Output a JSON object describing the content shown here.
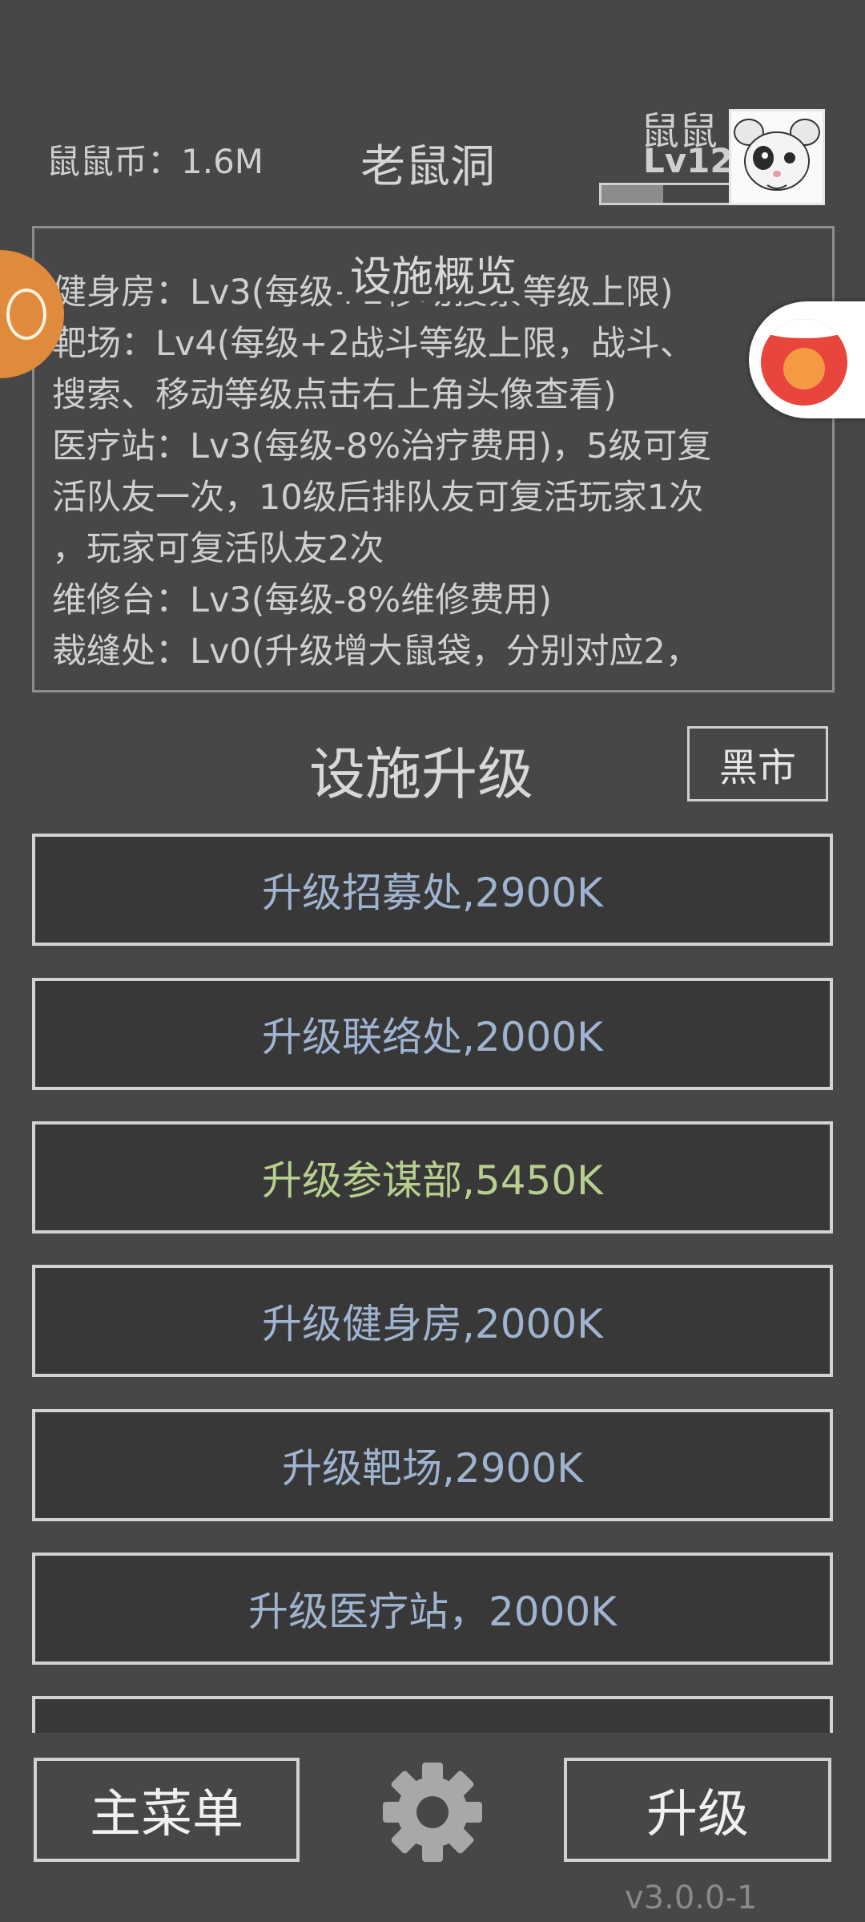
{
  "header": {
    "coins_label": "鼠鼠币：1.6M",
    "location_title": "老鼠洞",
    "user_name": "鼠鼠",
    "user_level": "Lv12",
    "xp_progress": 0.48
  },
  "overview": {
    "title": "设施概览",
    "text": "健身房：Lv3(每级+2移动搜索等级上限)\n靶场：Lv4(每级+2战斗等级上限，战斗、\n搜索、移动等级点击右上角头像查看)\n医疗站：Lv3(每级-8%治疗费用)，5级可复\n活队友一次，10级后排队友可复活玩家1次\n，玩家可复活队友2次\n维修台：Lv3(每级-8%维修费用)\n裁缝处：Lv0(升级增大鼠袋，分别对应2，"
  },
  "upgrades": {
    "title": "设施升级",
    "black_market_label": "黑市",
    "items": [
      {
        "label": "升级招募处,2900K",
        "highlight": false
      },
      {
        "label": "升级联络处,2000K",
        "highlight": false
      },
      {
        "label": "升级参谋部,5450K",
        "highlight": true
      },
      {
        "label": "升级健身房,2000K",
        "highlight": false
      },
      {
        "label": "升级靶场,2900K",
        "highlight": false
      },
      {
        "label": "升级医疗站，2000K",
        "highlight": false
      },
      {
        "label": "",
        "highlight": false
      }
    ]
  },
  "footer": {
    "main_menu_label": "主菜单",
    "upgrade_label": "升级",
    "settings_icon": "gear-icon",
    "version": "v3.0.0-1"
  },
  "colors": {
    "background": "#474747",
    "button_fill": "#383838",
    "button_text": "#9fb4d0",
    "highlight_text": "#b7d08e"
  }
}
